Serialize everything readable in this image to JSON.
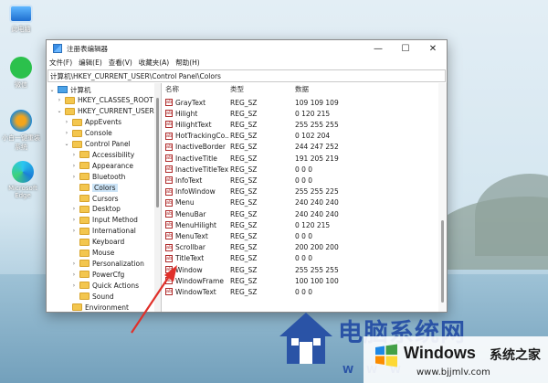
{
  "desktop": {
    "icons": [
      {
        "label": "此电脑"
      },
      {
        "label": "微信"
      },
      {
        "label": "小白一键重装系统"
      },
      {
        "label": "Microsoft Edge"
      }
    ]
  },
  "window": {
    "title": "注册表编辑器",
    "controls": {
      "minimize": "—",
      "maximize": "☐",
      "close": "✕"
    },
    "menu": [
      "文件(F)",
      "编辑(E)",
      "查看(V)",
      "收藏夹(A)",
      "帮助(H)"
    ],
    "address": "计算机\\HKEY_CURRENT_USER\\Control Panel\\Colors"
  },
  "tree": {
    "nodes": [
      {
        "label": "计算机",
        "expander": "⌄",
        "icon": "computer-icon"
      },
      {
        "label": "HKEY_CLASSES_ROOT",
        "expander": "›",
        "icon": "folder-icon"
      },
      {
        "label": "HKEY_CURRENT_USER",
        "expander": "⌄",
        "icon": "folder-icon"
      },
      {
        "label": "AppEvents",
        "expander": "›",
        "icon": "folder-icon"
      },
      {
        "label": "Console",
        "expander": "›",
        "icon": "folder-icon"
      },
      {
        "label": "Control Panel",
        "expander": "⌄",
        "icon": "folder-icon"
      },
      {
        "label": "Accessibility",
        "expander": "›",
        "icon": "folder-icon"
      },
      {
        "label": "Appearance",
        "expander": "›",
        "icon": "folder-icon"
      },
      {
        "label": "Bluetooth",
        "expander": "›",
        "icon": "folder-icon"
      },
      {
        "label": "Colors",
        "expander": "",
        "icon": "folder-icon",
        "selected": true
      },
      {
        "label": "Cursors",
        "expander": "",
        "icon": "folder-icon"
      },
      {
        "label": "Desktop",
        "expander": "›",
        "icon": "folder-icon"
      },
      {
        "label": "Input Method",
        "expander": "›",
        "icon": "folder-icon"
      },
      {
        "label": "International",
        "expander": "›",
        "icon": "folder-icon"
      },
      {
        "label": "Keyboard",
        "expander": "",
        "icon": "folder-icon"
      },
      {
        "label": "Mouse",
        "expander": "",
        "icon": "folder-icon"
      },
      {
        "label": "Personalization",
        "expander": "›",
        "icon": "folder-icon"
      },
      {
        "label": "PowerCfg",
        "expander": "›",
        "icon": "folder-icon"
      },
      {
        "label": "Quick Actions",
        "expander": "›",
        "icon": "folder-icon"
      },
      {
        "label": "Sound",
        "expander": "",
        "icon": "folder-icon"
      },
      {
        "label": "Environment",
        "expander": "",
        "icon": "folder-icon"
      }
    ]
  },
  "list": {
    "headers": {
      "name": "名称",
      "type": "类型",
      "data": "数据"
    },
    "rows": [
      {
        "name": "GrayText",
        "type": "REG_SZ",
        "data": "109 109 109"
      },
      {
        "name": "Hilight",
        "type": "REG_SZ",
        "data": "0 120 215"
      },
      {
        "name": "HilightText",
        "type": "REG_SZ",
        "data": "255 255 255"
      },
      {
        "name": "HotTrackingCo...",
        "type": "REG_SZ",
        "data": "0 102 204"
      },
      {
        "name": "InactiveBorder",
        "type": "REG_SZ",
        "data": "244 247 252"
      },
      {
        "name": "InactiveTitle",
        "type": "REG_SZ",
        "data": "191 205 219"
      },
      {
        "name": "InactiveTitleText",
        "type": "REG_SZ",
        "data": "0 0 0"
      },
      {
        "name": "InfoText",
        "type": "REG_SZ",
        "data": "0 0 0"
      },
      {
        "name": "InfoWindow",
        "type": "REG_SZ",
        "data": "255 255 225"
      },
      {
        "name": "Menu",
        "type": "REG_SZ",
        "data": "240 240 240"
      },
      {
        "name": "MenuBar",
        "type": "REG_SZ",
        "data": "240 240 240"
      },
      {
        "name": "MenuHilight",
        "type": "REG_SZ",
        "data": "0 120 215"
      },
      {
        "name": "MenuText",
        "type": "REG_SZ",
        "data": "0 0 0"
      },
      {
        "name": "Scrollbar",
        "type": "REG_SZ",
        "data": "200 200 200"
      },
      {
        "name": "TitleText",
        "type": "REG_SZ",
        "data": "0 0 0"
      },
      {
        "name": "Window",
        "type": "REG_SZ",
        "data": "255 255 255"
      },
      {
        "name": "WindowFrame",
        "type": "REG_SZ",
        "data": "100 100 100"
      },
      {
        "name": "WindowText",
        "type": "REG_SZ",
        "data": "0 0 0"
      }
    ],
    "value_icon": "ab"
  },
  "watermark": {
    "site_cn": "电脑系统网",
    "www": "W W W",
    "windows_brand": "Windows",
    "windows_cn": "系统之家",
    "url": "www.bjjmlv.com"
  },
  "colors": {
    "selection": "#cce4f7",
    "arrow": "#e0302a",
    "watermark_blue": "#2a53a6"
  }
}
